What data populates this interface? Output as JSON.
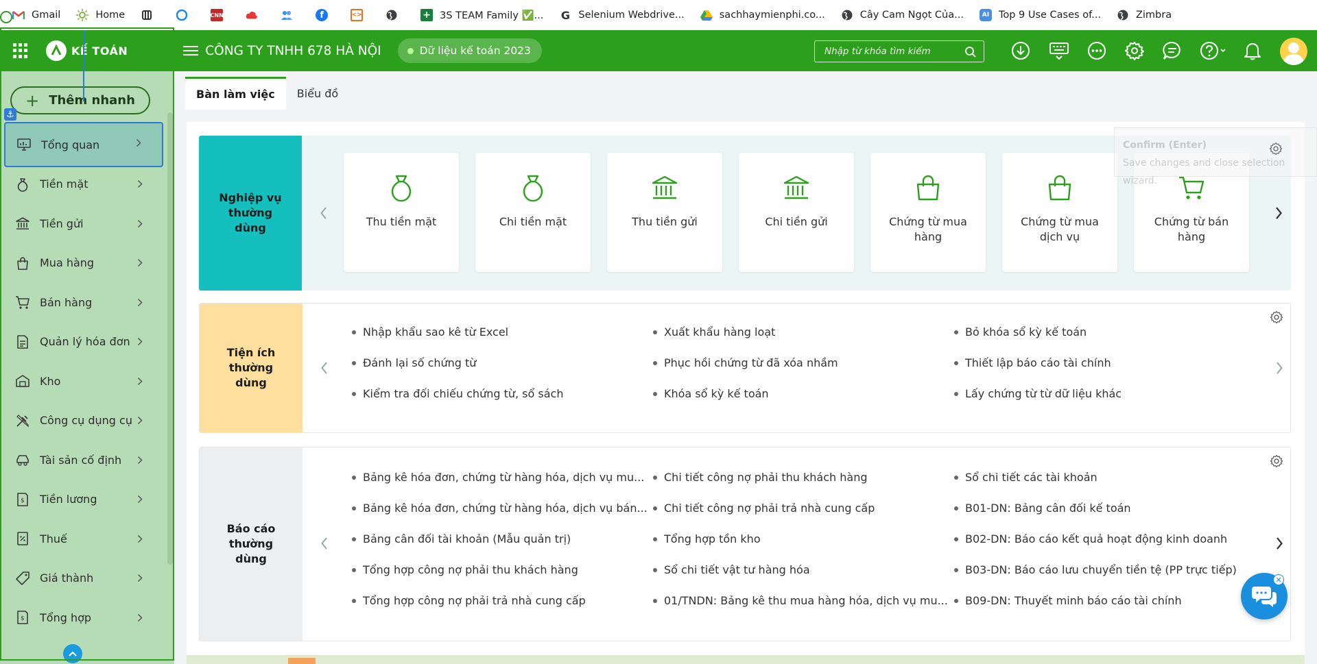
{
  "bookmarks": [
    {
      "label": "Gmail",
      "icon": "gmail-icon"
    },
    {
      "label": "Home",
      "icon": "sun-icon"
    },
    {
      "label": "",
      "icon": "tool-icon"
    },
    {
      "label": "",
      "icon": "ring-icon"
    },
    {
      "label": "",
      "icon": "cnn-icon"
    },
    {
      "label": "",
      "icon": "cloud-icon"
    },
    {
      "label": "",
      "icon": "people-icon"
    },
    {
      "label": "",
      "icon": "facebook-icon"
    },
    {
      "label": "",
      "icon": "xml-icon"
    },
    {
      "label": "",
      "icon": "globe-icon"
    },
    {
      "label": "3S TEAM Family ✅...",
      "icon": "green-plus-icon"
    },
    {
      "label": "Selenium Webdrive...",
      "icon": "google-icon"
    },
    {
      "label": "sachhaymienphi.co...",
      "icon": "drive-icon"
    },
    {
      "label": "Cây Cam Ngọt Của...",
      "icon": "globe-icon"
    },
    {
      "label": "Top 9 Use Cases of...",
      "icon": "ai-icon"
    },
    {
      "label": "Zimbra",
      "icon": "globe-icon"
    }
  ],
  "header": {
    "logo_text": "KẾ TOÁN",
    "company": "CÔNG TY TNHH 678 HÀ NỘI",
    "dataset": "Dữ liệu kế toán 2023",
    "search_placeholder": "Nhập từ khóa tìm kiếm"
  },
  "sidebar": {
    "quick_add": "Thêm nhanh",
    "items": [
      {
        "label": "Tổng quan",
        "icon": "monitor-icon",
        "active": true
      },
      {
        "label": "Tiền mặt",
        "icon": "money-bag-icon"
      },
      {
        "label": "Tiền gửi",
        "icon": "bank-icon"
      },
      {
        "label": "Mua hàng",
        "icon": "shopping-bag-icon"
      },
      {
        "label": "Bán hàng",
        "icon": "cart-icon"
      },
      {
        "label": "Quản lý hóa đơn",
        "icon": "invoice-icon"
      },
      {
        "label": "Kho",
        "icon": "warehouse-icon"
      },
      {
        "label": "Công cụ dụng cụ",
        "icon": "tools-icon"
      },
      {
        "label": "Tài sản cố định",
        "icon": "car-icon"
      },
      {
        "label": "Tiền lương",
        "icon": "salary-icon"
      },
      {
        "label": "Thuế",
        "icon": "tax-icon"
      },
      {
        "label": "Giá thành",
        "icon": "price-tag-icon"
      },
      {
        "label": "Tổng hợp",
        "icon": "summary-icon"
      }
    ]
  },
  "tabs": [
    {
      "label": "Bàn làm việc",
      "active": true
    },
    {
      "label": "Biểu đồ",
      "active": false
    }
  ],
  "operations": {
    "title": "Nghiệp vụ thường dùng",
    "cards": [
      {
        "label": "Thu tiền mặt",
        "icon": "money-bag-icon"
      },
      {
        "label": "Chi tiền mặt",
        "icon": "money-bag-icon"
      },
      {
        "label": "Thu tiền gửi",
        "icon": "bank-icon"
      },
      {
        "label": "Chi tiền gửi",
        "icon": "bank-icon"
      },
      {
        "label": "Chứng từ mua hàng",
        "icon": "shopping-bag-icon"
      },
      {
        "label": "Chứng từ mua dịch vụ",
        "icon": "shopping-bag-icon"
      },
      {
        "label": "Chứng từ bán hàng",
        "icon": "cart-icon"
      }
    ]
  },
  "utilities": {
    "title": "Tiện ích thường dùng",
    "links": [
      "Nhập khẩu sao kê từ Excel",
      "Xuất khẩu hàng loạt",
      "Bỏ khóa sổ kỳ kế toán",
      "Đánh lại số chứng từ",
      "Phục hồi chứng từ đã xóa nhầm",
      "Thiết lập báo cáo tài chính",
      "Kiểm tra đối chiếu chứng từ, sổ sách",
      "Khóa sổ kỳ kế toán",
      "Lấy chứng từ từ dữ liệu khác"
    ]
  },
  "reports": {
    "title": "Báo cáo thường dùng",
    "links": [
      "Bảng kê hóa đơn, chứng từ hàng hóa, dịch vụ mu...",
      "Chi tiết công nợ phải thu khách hàng",
      "Sổ chi tiết các tài khoản",
      "Bảng kê hóa đơn, chứng từ hàng hóa, dịch vụ bán...",
      "Chi tiết công nợ phải trả nhà cung cấp",
      "B01-DN: Bảng cân đối kế toán",
      "Bảng cân đối tài khoản (Mẫu quản trị)",
      "Tổng hợp tồn kho",
      "B02-DN: Báo cáo kết quả hoạt động kinh doanh",
      "Tổng hợp công nợ phải thu khách hàng",
      "Sổ chi tiết vật tư hàng hóa",
      "B03-DN: Báo cáo lưu chuyển tiền tệ (PP trực tiếp)",
      "Tổng hợp công nợ phải trả nhà cung cấp",
      "01/TNDN: Bảng kê thu mua hàng hóa, dịch vụ mu...",
      "B09-DN: Thuyết minh báo cáo tài chính"
    ]
  },
  "confirm_tip": {
    "title": "Confirm (Enter)",
    "body": "Save changes and close selection wizard."
  },
  "colors": {
    "brand_green": "#2ca01c",
    "ops_teal": "#14bfbd",
    "util_yellow": "#ffdf9e",
    "report_gray": "#eceef0",
    "sidebar_bg": "#b6dcb5",
    "chat_blue": "#1a8fde"
  }
}
